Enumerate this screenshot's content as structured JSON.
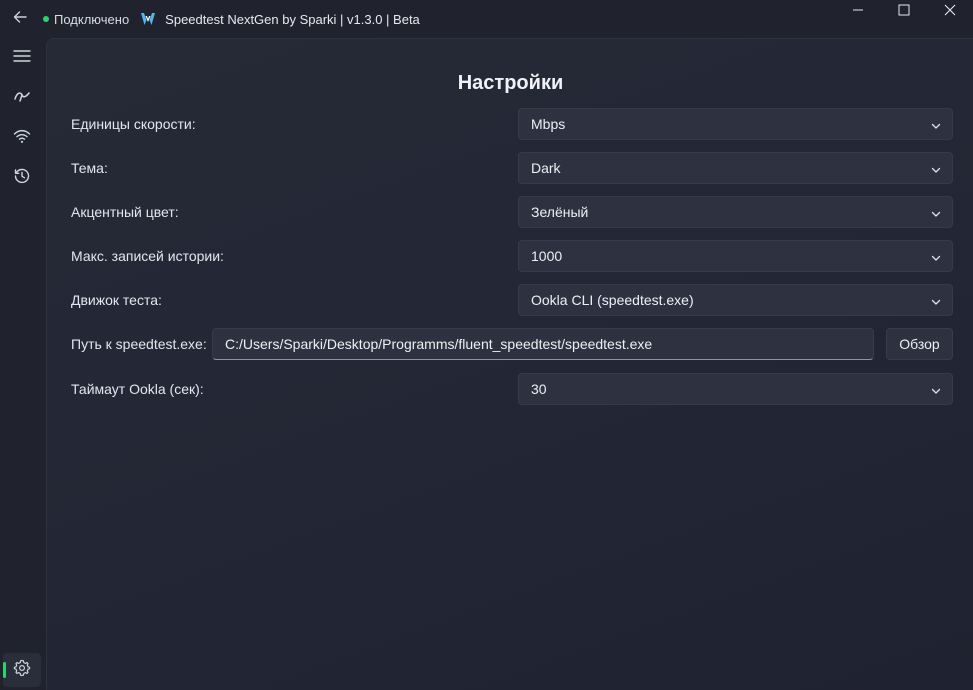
{
  "titlebar": {
    "status_text": "Подключено",
    "status_color": "#2bd46b",
    "app_title": "Speedtest NextGen by Sparki | v1.3.0 | Beta",
    "back_icon": "arrow-left-icon",
    "logo_icon": "app-logo-icon",
    "controls": [
      "minimize-icon",
      "maximize-icon",
      "close-icon"
    ]
  },
  "sidebar": {
    "items": [
      {
        "icon": "hamburger-menu-icon"
      },
      {
        "icon": "speedometer-icon"
      },
      {
        "icon": "wifi-icon"
      },
      {
        "icon": "history-icon"
      }
    ],
    "footer_item": {
      "icon": "settings-gear-icon",
      "active": true
    },
    "accent_color": "#2bd46b"
  },
  "page": {
    "title": "Настройки",
    "settings": {
      "speed_units": {
        "label": "Единицы скорости:",
        "value": "Mbps"
      },
      "theme": {
        "label": "Тема:",
        "value": "Dark"
      },
      "accent_color": {
        "label": "Акцентный цвет:",
        "value": "Зелёный"
      },
      "max_history": {
        "label": "Макс. записей истории:",
        "value": "1000"
      },
      "test_engine": {
        "label": "Движок теста:",
        "value": "Ookla CLI (speedtest.exe)"
      },
      "speedtest_path": {
        "label": "Путь к speedtest.exe:",
        "value": "C:/Users/Sparki/Desktop/Programms/fluent_speedtest/speedtest.exe",
        "browse_label": "Обзор"
      },
      "ookla_timeout": {
        "label": "Таймаут Ookla (сек):",
        "value": "30"
      }
    }
  }
}
